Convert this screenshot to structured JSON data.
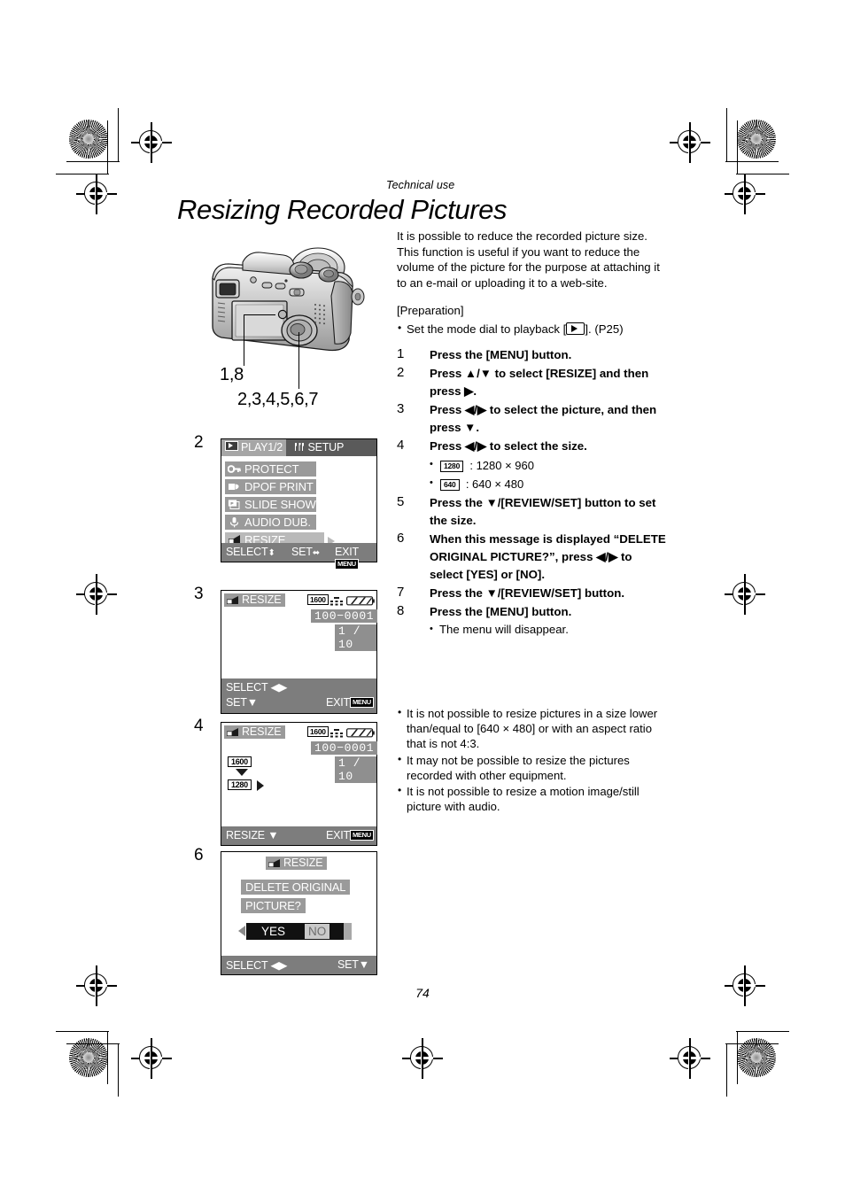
{
  "header": {
    "kicker": "Technical use",
    "title": "Resizing Recorded Pictures"
  },
  "intro": "It is possible to reduce the recorded picture size. This function is useful if you want to reduce the volume of the picture for the purpose at attaching it to an e-mail or uploading it to a web-site.",
  "preparation": {
    "label": "[Preparation]",
    "item": "Set the mode dial to playback [",
    "item_tail": "]. (P25)"
  },
  "steps": [
    {
      "num": "1",
      "text": "Press the [MENU] button."
    },
    {
      "num": "2",
      "text": "Press ▲/▼ to select [RESIZE] and then press ▶."
    },
    {
      "num": "3",
      "text": "Press ◀/▶ to select the picture, and then press ▼."
    },
    {
      "num": "4",
      "text": "Press ◀/▶ to select the size."
    },
    {
      "num": "5",
      "text": "Press the ▼/[REVIEW/SET] button to set the size."
    },
    {
      "num": "6",
      "text": "When this message is displayed “DELETE ORIGINAL PICTURE?”, press ◀/▶ to select [YES] or [NO]."
    },
    {
      "num": "7",
      "text": "Press the ▼/[REVIEW/SET] button."
    },
    {
      "num": "8",
      "text": "Press the [MENU] button."
    }
  ],
  "size_options": [
    {
      "badge": "1280",
      "text": ": 1280 × 960"
    },
    {
      "badge": "640",
      "text": ":  640 × 480"
    }
  ],
  "step8_sub": "The menu will disappear.",
  "notes": [
    "It is not possible to resize pictures in a size lower than/equal to [640 × 480] or with an aspect ratio that is not 4:3.",
    "It may not be possible to resize the pictures recorded with other equipment.",
    "It is not possible to resize a motion image/still picture with audio."
  ],
  "camera": {
    "callout_top": "1,8",
    "callout_bottom": "2,3,4,5,6,7"
  },
  "screens": {
    "menu": {
      "step_label": "2",
      "tabs": [
        {
          "label": "PLAY1/2",
          "icon": "play-icon",
          "selected": true
        },
        {
          "label": "SETUP",
          "icon": "wrench-icon",
          "selected": false
        }
      ],
      "items": [
        {
          "label": "PROTECT",
          "icon": "key-icon",
          "selected": false
        },
        {
          "label": "DPOF PRINT",
          "icon": "print-icon",
          "selected": false
        },
        {
          "label": "SLIDE SHOW",
          "icon": "slides-icon",
          "selected": false
        },
        {
          "label": "AUDIO DUB.",
          "icon": "microphone-icon",
          "selected": false
        },
        {
          "label": "RESIZE",
          "icon": "resize-icon",
          "selected": true
        }
      ],
      "footer": {
        "select": "SELECT",
        "set": "SET",
        "exit": "EXIT",
        "menu_key": "MENU"
      }
    },
    "select_picture": {
      "step_label": "3",
      "title": "RESIZE",
      "size_badge": "1600",
      "file_number": "100−0001",
      "frame_counter": "1 / 10",
      "footer": {
        "select": "SELECT ◀▶",
        "set": "SET▼",
        "exit": "EXIT",
        "menu_key": "MENU"
      }
    },
    "select_size": {
      "step_label": "4",
      "title": "RESIZE",
      "size_badge": "1600",
      "file_number": "100−0001",
      "frame_counter": "1 / 10",
      "from_size": "1600",
      "to_size": "1280",
      "footer": {
        "resize": "RESIZE ▼",
        "exit": "EXIT",
        "menu_key": "MENU"
      }
    },
    "confirm": {
      "step_label": "6",
      "title": "RESIZE",
      "message_line1": "DELETE ORIGINAL",
      "message_line2": "PICTURE?",
      "yes_label": "YES",
      "no_label": "NO",
      "footer": {
        "select": "SELECT ◀▶",
        "set": "SET▼"
      }
    }
  },
  "page_number": "74"
}
